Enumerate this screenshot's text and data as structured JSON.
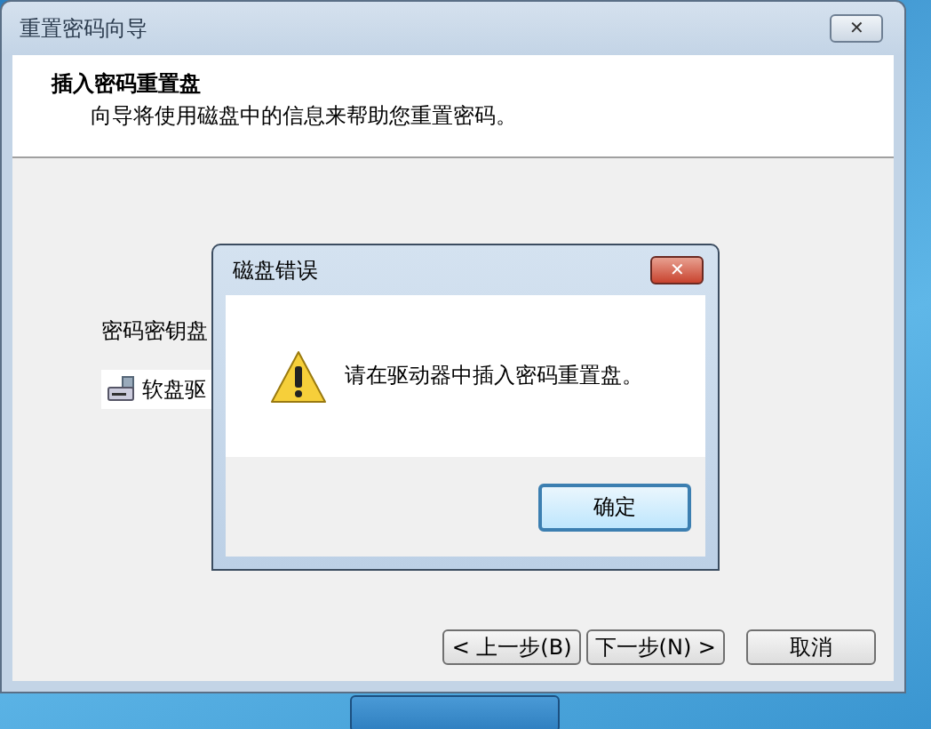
{
  "window": {
    "title": "重置密码向导",
    "close": "✕"
  },
  "header": {
    "heading": "插入密码重置盘",
    "subtitle": "向导将使用磁盘中的信息来帮助您重置密码。"
  },
  "body": {
    "label": "密码密钥盘",
    "drive": "软盘驱"
  },
  "buttons": [
    {
      "label": "< 上一步(B)",
      "kind": "nav"
    },
    {
      "label": "下一步(N) >",
      "kind": "nav"
    },
    {
      "label": "取消",
      "kind": "cancel"
    }
  ],
  "dialog": {
    "title": "磁盘错误",
    "close": "✕",
    "message": "请在驱动器中插入密码重置盘。",
    "ok": "确定",
    "ok_focused": true
  }
}
